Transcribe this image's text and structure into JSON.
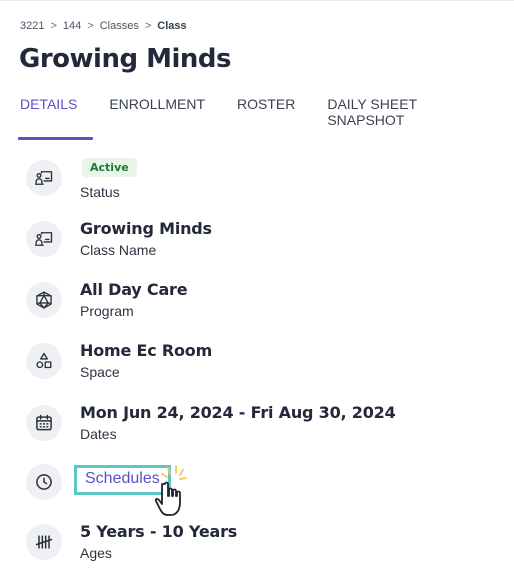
{
  "breadcrumb": {
    "items": [
      "3221",
      "144",
      "Classes",
      "Class"
    ],
    "separator": ">"
  },
  "page_title": "Growing Minds",
  "tabs": [
    {
      "label": "DETAILS",
      "active": true
    },
    {
      "label": "ENROLLMENT",
      "active": false
    },
    {
      "label": "ROSTER",
      "active": false
    },
    {
      "label": "DAILY SHEET SNAPSHOT",
      "active": false
    }
  ],
  "details": {
    "status": {
      "value": "Active",
      "label": "Status",
      "icon": "classroom-icon"
    },
    "class_name": {
      "value": "Growing Minds",
      "label": "Class Name",
      "icon": "classroom-icon"
    },
    "program": {
      "value": "All Day Care",
      "label": "Program",
      "icon": "polyhedron-icon"
    },
    "space": {
      "value": "Home Ec Room",
      "label": "Space",
      "icon": "shapes-icon"
    },
    "dates": {
      "value": "Mon Jun 24, 2024 - Fri Aug 30, 2024",
      "label": "Dates",
      "icon": "calendar-icon"
    },
    "schedules": {
      "link": "Schedules",
      "icon": "clock-icon"
    },
    "ages": {
      "value": "5 Years - 10 Years",
      "label": "Ages",
      "icon": "tally-icon"
    }
  },
  "colors": {
    "accent": "#5a50c7",
    "badge_bg": "#e8f5e9",
    "badge_text": "#1f7a3a",
    "highlight": "#5cc7c7"
  }
}
